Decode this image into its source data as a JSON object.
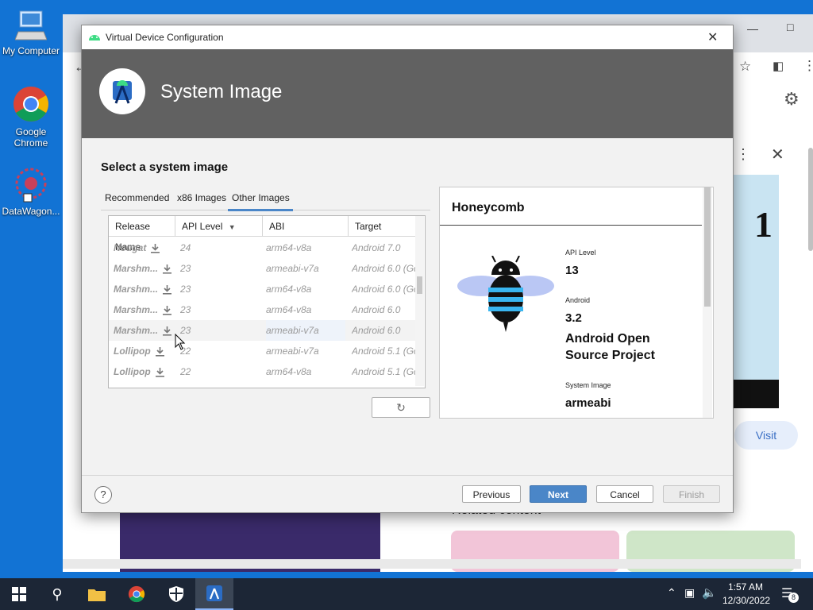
{
  "desktop": {
    "icons": [
      {
        "label": "My Computer",
        "icon": "computer-icon"
      },
      {
        "label": "Google Chrome",
        "icon": "chrome-icon"
      },
      {
        "label": "DataWagon...",
        "icon": "datawagon-icon"
      }
    ]
  },
  "browser": {
    "visit_label": "Visit",
    "related_label": "Related content",
    "comic_number": "1"
  },
  "dialog": {
    "title": "Virtual Device Configuration",
    "header_title": "System Image",
    "subtitle": "Select a system image",
    "tabs": [
      "Recommended",
      "x86 Images",
      "Other Images"
    ],
    "active_tab": "Other Images",
    "columns": [
      "Release Name",
      "API Level",
      "ABI",
      "Target"
    ],
    "rows": [
      {
        "name": "Nougat",
        "api": "24",
        "abi": "arm64-v8a",
        "target": "Android 7.0"
      },
      {
        "name": "Marshm...",
        "api": "23",
        "abi": "armeabi-v7a",
        "target": "Android 6.0 (Gc"
      },
      {
        "name": "Marshm...",
        "api": "23",
        "abi": "arm64-v8a",
        "target": "Android 6.0 (Gc"
      },
      {
        "name": "Marshm...",
        "api": "23",
        "abi": "arm64-v8a",
        "target": "Android 6.0"
      },
      {
        "name": "Marshm...",
        "api": "23",
        "abi": "armeabi-v7a",
        "target": "Android 6.0"
      },
      {
        "name": "Lollipop",
        "api": "22",
        "abi": "armeabi-v7a",
        "target": "Android 5.1 (Gc"
      },
      {
        "name": "Lollipop",
        "api": "22",
        "abi": "arm64-v8a",
        "target": "Android 5.1 (Gc"
      }
    ],
    "detail": {
      "title": "Honeycomb",
      "api_label": "API Level",
      "api_value": "13",
      "android_label": "Android",
      "android_value": "3.2",
      "vendor": "Android Open Source Project",
      "image_label": "System Image",
      "image_value": "armeabi"
    },
    "buttons": {
      "help": "?",
      "previous": "Previous",
      "next": "Next",
      "cancel": "Cancel",
      "finish": "Finish"
    }
  },
  "taskbar": {
    "time": "1:57 AM",
    "date": "12/30/2022",
    "notifications": "8"
  },
  "colors": {
    "desktop": "#1273d4",
    "dialog_header": "#616161",
    "primary_button": "#4a86c8",
    "taskbar": "#1c2636"
  }
}
